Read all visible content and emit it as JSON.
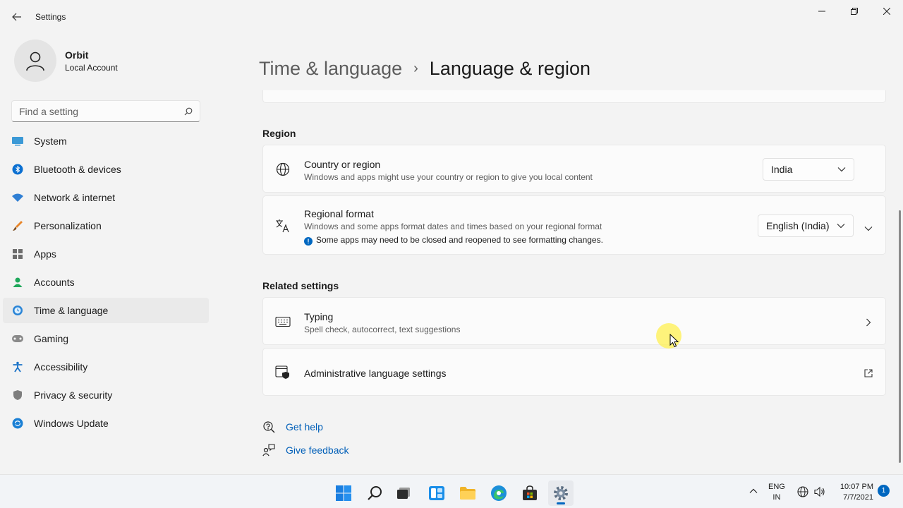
{
  "window": {
    "title": "Settings"
  },
  "profile": {
    "name": "Orbit",
    "account_type": "Local Account"
  },
  "search": {
    "placeholder": "Find a setting"
  },
  "nav": {
    "items": [
      {
        "label": "System",
        "icon": "system-icon"
      },
      {
        "label": "Bluetooth & devices",
        "icon": "bluetooth-icon"
      },
      {
        "label": "Network & internet",
        "icon": "wifi-icon"
      },
      {
        "label": "Personalization",
        "icon": "brush-icon"
      },
      {
        "label": "Apps",
        "icon": "apps-icon"
      },
      {
        "label": "Accounts",
        "icon": "person-icon"
      },
      {
        "label": "Time & language",
        "icon": "clock-globe-icon",
        "selected": true
      },
      {
        "label": "Gaming",
        "icon": "gamepad-icon"
      },
      {
        "label": "Accessibility",
        "icon": "accessibility-icon"
      },
      {
        "label": "Privacy & security",
        "icon": "shield-icon"
      },
      {
        "label": "Windows Update",
        "icon": "update-icon"
      }
    ]
  },
  "breadcrumb": {
    "parent": "Time & language",
    "separator": "›",
    "current": "Language & region"
  },
  "region": {
    "section_title": "Region",
    "country": {
      "title": "Country or region",
      "description": "Windows and apps might use your country or region to give you local content",
      "value": "India"
    },
    "regional_format": {
      "title": "Regional format",
      "description": "Windows and some apps format dates and times based on your regional format",
      "notice": "Some apps may need to be closed and reopened to see formatting changes.",
      "value": "English (India)"
    }
  },
  "related": {
    "section_title": "Related settings",
    "typing": {
      "title": "Typing",
      "description": "Spell check, autocorrect, text suggestions"
    },
    "admin": {
      "title": "Administrative language settings"
    }
  },
  "help": {
    "get_help": "Get help",
    "give_feedback": "Give feedback"
  },
  "taskbar": {
    "lang_line1": "ENG",
    "lang_line2": "IN",
    "time": "10:07 PM",
    "date": "7/7/2021",
    "notifications": "1"
  },
  "colors": {
    "accent": "#0067c0",
    "link": "#005fb8",
    "background": "#f3f3f3",
    "card": "#fbfbfb"
  }
}
